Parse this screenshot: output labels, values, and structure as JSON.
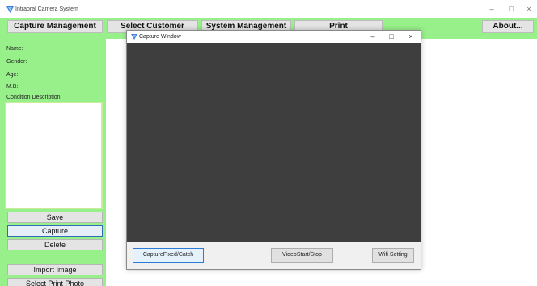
{
  "window": {
    "title": "Intraoral Camera System",
    "controls": {
      "minimize": "–",
      "maximize": "□",
      "close": "×"
    }
  },
  "menu": {
    "capture_management": "Capture Management",
    "select_customer": "Select Customer",
    "system_management": "System Management",
    "print": "Print",
    "about": "About..."
  },
  "patient": {
    "name_label": "Name:",
    "gender_label": "Gender:",
    "age_label": "Age:",
    "mb_label": "M.B:",
    "condition_label": "Condition Description:",
    "condition_value": ""
  },
  "sidebar": {
    "save": "Save",
    "capture": "Capture",
    "delete": "Delete",
    "import_image": "Import Image",
    "select_print_photo": "Select Print Photo"
  },
  "capture_window": {
    "title": "Capture Window",
    "controls": {
      "minimize": "–",
      "maximize": "□",
      "close": "×"
    },
    "buttons": {
      "capture_fixed": "CaptureFixed/Catch",
      "video_start_stop": "VideoStart/Stop",
      "wifi_setting": "Wifi Setting"
    }
  },
  "colors": {
    "panel_green": "#98f08a",
    "video_bg": "#3e3e3e",
    "focus_blue": "#2b7ad6"
  },
  "icons": {
    "app": "app-logo-icon"
  }
}
